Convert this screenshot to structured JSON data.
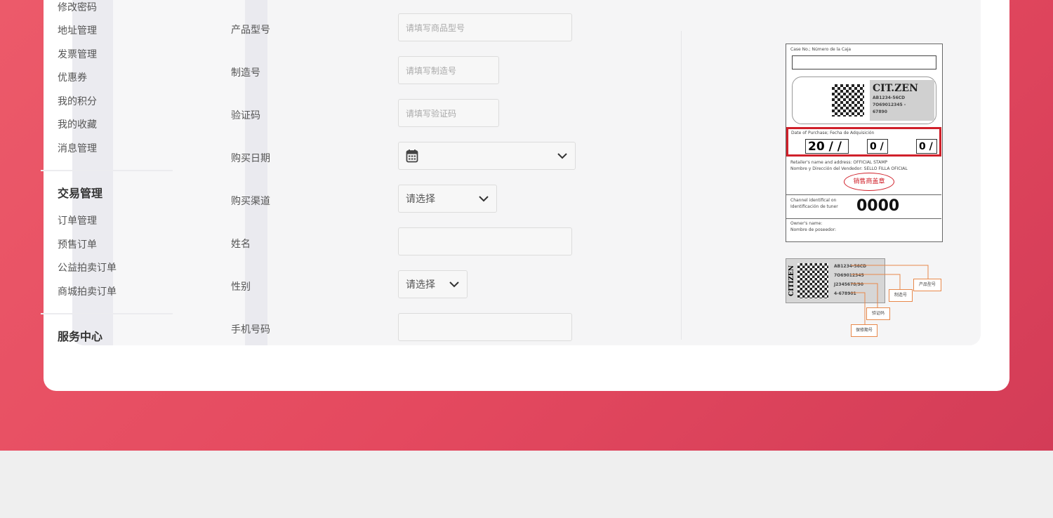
{
  "sidebar": {
    "account_items": [
      "修改密码",
      "地址管理",
      "发票管理",
      "优惠券",
      "我的积分",
      "我的收藏",
      "消息管理"
    ],
    "trade_heading": "交易管理",
    "trade_items": [
      "订单管理",
      "预售订单",
      "公益拍卖订单",
      "商城拍卖订单"
    ],
    "service_heading": "服务中心"
  },
  "form": {
    "model": {
      "label": "产品型号",
      "placeholder": "请填写商品型号"
    },
    "serial": {
      "label": "制造号",
      "placeholder": "请填写制造号"
    },
    "code": {
      "label": "验证码",
      "placeholder": "请填写验证码"
    },
    "date": {
      "label": "购买日期"
    },
    "channel": {
      "label": "购买渠道",
      "value": "请选择"
    },
    "name": {
      "label": "姓名"
    },
    "gender": {
      "label": "性别",
      "value": "请选择"
    },
    "phone": {
      "label": "手机号码"
    }
  },
  "warranty_card": {
    "case_no_label": "Case No.; Número de la Caja",
    "brand": "CIT.ZEN",
    "model_code": "AB1234-56CD",
    "serial_1": "7O69012345 -",
    "serial_2": "67890",
    "purchase_label": "Date of Purchase; Fecha de Adquisición",
    "year": "20 / /",
    "month": "0 /",
    "day": "0 /",
    "retailer_label": "Retailer's name and address: OFFICIAL STAMP",
    "retailer_label_2": "Nombre y Dirección del Vendedor: SELLO FILLA OFICIAL",
    "stamp": "销售商盖章",
    "channel_label": "Channel identifical on",
    "channel_label_2": "Identificación de tuner",
    "channel_number": "0000",
    "owner_label": "Owner's name:",
    "owner_label_2": "Nombre de poseedor:"
  },
  "tag": {
    "brand": "CITIZEN",
    "lines": [
      "AB1234-56CD",
      "7O69012345",
      "J2345678/90",
      "4-678901"
    ],
    "callouts": [
      "产品型号",
      "制造号",
      "验证码",
      "保修期号"
    ]
  },
  "colors": {
    "accent": "#e4495f",
    "highlight_red": "#d0202a",
    "callout_orange": "#e8884a"
  }
}
